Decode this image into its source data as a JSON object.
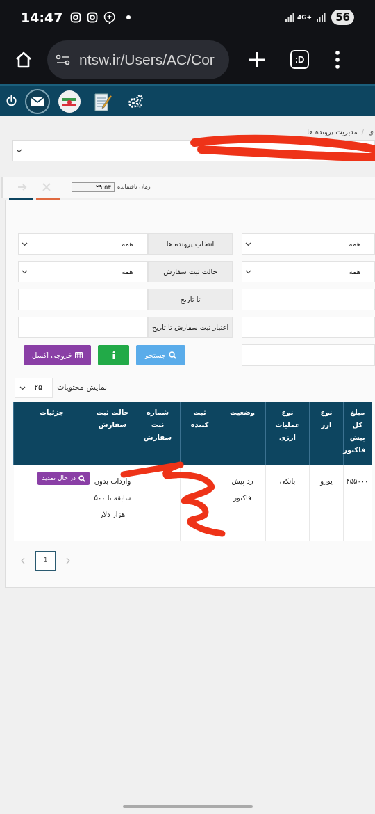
{
  "status_bar": {
    "time": "14:47",
    "network": "4G+",
    "battery": "56"
  },
  "browser": {
    "url": "ntsw.ir/Users/AC/Cor",
    "tab_label": ":D"
  },
  "breadcrumb": {
    "items": [
      "ی",
      "مدیریت پرونده ها"
    ],
    "separator": "/"
  },
  "timer": {
    "label": "زمان باقیمانده",
    "value": "۲۹:۵۴"
  },
  "filters": {
    "left": [
      {
        "kind": "select",
        "label": "انتخاب پرونده ها",
        "value": "همه"
      },
      {
        "kind": "select",
        "label": "حالت ثبت سفارش",
        "value": "همه"
      },
      {
        "kind": "input",
        "label": "تا تاریخ"
      },
      {
        "kind": "input",
        "label": "اعتبار ثبت سفارش تا تاریخ"
      }
    ],
    "right": [
      {
        "kind": "select",
        "value": "همه"
      },
      {
        "kind": "select",
        "value": "همه"
      },
      {
        "kind": "input"
      },
      {
        "kind": "input"
      },
      {
        "kind": "input"
      }
    ],
    "buttons": [
      {
        "kind": "search",
        "label": "جستجو"
      },
      {
        "kind": "info"
      },
      {
        "kind": "excel",
        "label": "خروجی اکسل"
      }
    ]
  },
  "page_size": {
    "label": "نمایش محتویات",
    "value": "۲۵"
  },
  "table": {
    "columns": [
      "مبلغ کل پیش فاکتور",
      "نوع ارز",
      "نوع عملیات ارزی",
      "وضعیت",
      "ثبت کننده",
      "شماره ثبت سفارش",
      "حالت ثبت سفارش",
      "جزئیات"
    ],
    "rows": [
      {
        "amount": "۴۵۵۰۰۰",
        "currency": "یورو",
        "operation": "بانکی",
        "status": "رد پیش فاکتور",
        "order_state": "واردات بدون سابقه تا ۵۰۰ هزار دلار",
        "action": "در حال تمدید"
      }
    ]
  },
  "pagination": {
    "pages": [
      {
        "label": "1",
        "selected": true
      }
    ]
  }
}
